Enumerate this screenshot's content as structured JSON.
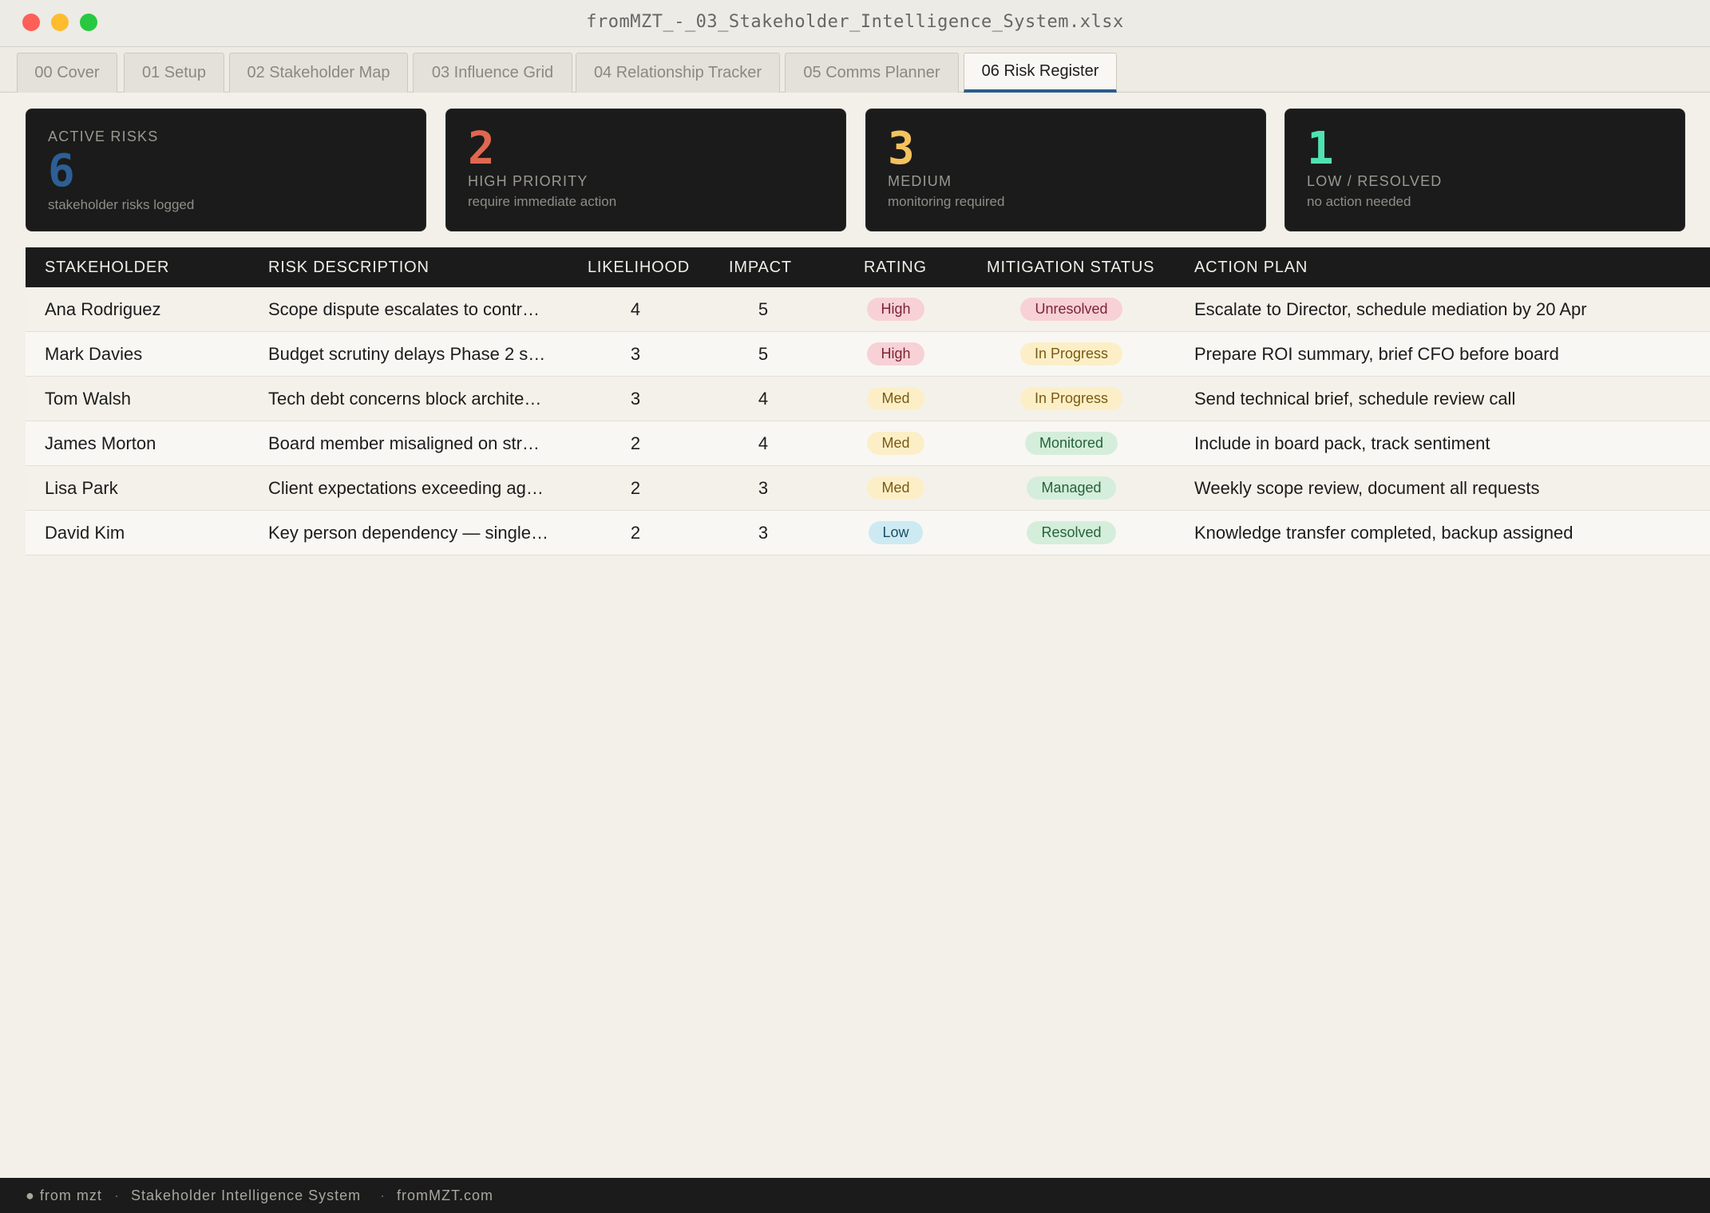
{
  "window": {
    "title": "fromMZT_-_03_Stakeholder_Intelligence_System.xlsx"
  },
  "tabs": [
    {
      "label": "00 Cover",
      "active": false
    },
    {
      "label": "01 Setup",
      "active": false
    },
    {
      "label": "02 Stakeholder Map",
      "active": false
    },
    {
      "label": "03 Influence Grid",
      "active": false
    },
    {
      "label": "04 Relationship Tracker",
      "active": false
    },
    {
      "label": "05 Comms Planner",
      "active": false
    },
    {
      "label": "06 Risk Register",
      "active": true
    }
  ],
  "summary": {
    "active": {
      "label": "ACTIVE RISKS",
      "value": "6",
      "sub": "stakeholder risks logged",
      "color": "#2d5f95"
    },
    "high": {
      "label": "HIGH PRIORITY",
      "value": "2",
      "sub": "require immediate action",
      "color": "#e0674f"
    },
    "medium": {
      "label": "MEDIUM",
      "value": "3",
      "sub": "monitoring required",
      "color": "#f4c25e"
    },
    "low": {
      "label": "LOW / RESOLVED",
      "value": "1",
      "sub": "no action needed",
      "color": "#4fe3b2"
    }
  },
  "table": {
    "columns": {
      "stakeholder": "STAKEHOLDER",
      "description": "RISK DESCRIPTION",
      "likelihood": "LIKELIHOOD",
      "impact": "IMPACT",
      "rating": "RATING",
      "status": "MITIGATION STATUS",
      "action": "ACTION PLAN"
    },
    "rows": [
      {
        "stakeholder": "Ana Rodriguez",
        "description": "Scope dispute escalates to contr…",
        "likelihood": "4",
        "impact": "5",
        "rating": "High",
        "status": "Unresolved",
        "action": "Escalate to Director, schedule mediation by 20 Apr"
      },
      {
        "stakeholder": "Mark Davies",
        "description": "Budget scrutiny delays Phase 2 s…",
        "likelihood": "3",
        "impact": "5",
        "rating": "High",
        "status": "In Progress",
        "action": "Prepare ROI summary, brief CFO before board"
      },
      {
        "stakeholder": "Tom Walsh",
        "description": "Tech debt concerns block archite…",
        "likelihood": "3",
        "impact": "4",
        "rating": "Med",
        "status": "In Progress",
        "action": "Send technical brief, schedule review call"
      },
      {
        "stakeholder": "James Morton",
        "description": "Board member misaligned on str…",
        "likelihood": "2",
        "impact": "4",
        "rating": "Med",
        "status": "Monitored",
        "action": "Include in board pack, track sentiment"
      },
      {
        "stakeholder": "Lisa Park",
        "description": "Client expectations exceeding ag…",
        "likelihood": "2",
        "impact": "3",
        "rating": "Med",
        "status": "Managed",
        "action": "Weekly scope review, document all requests"
      },
      {
        "stakeholder": "David Kim",
        "description": "Key person dependency — single…",
        "likelihood": "2",
        "impact": "3",
        "rating": "Low",
        "status": "Resolved",
        "action": "Knowledge transfer completed, backup assigned"
      }
    ]
  },
  "footer": {
    "brand": "● from mzt",
    "separator": "·",
    "system": "Stakeholder Intelligence System",
    "site": "fromMZT.com"
  }
}
